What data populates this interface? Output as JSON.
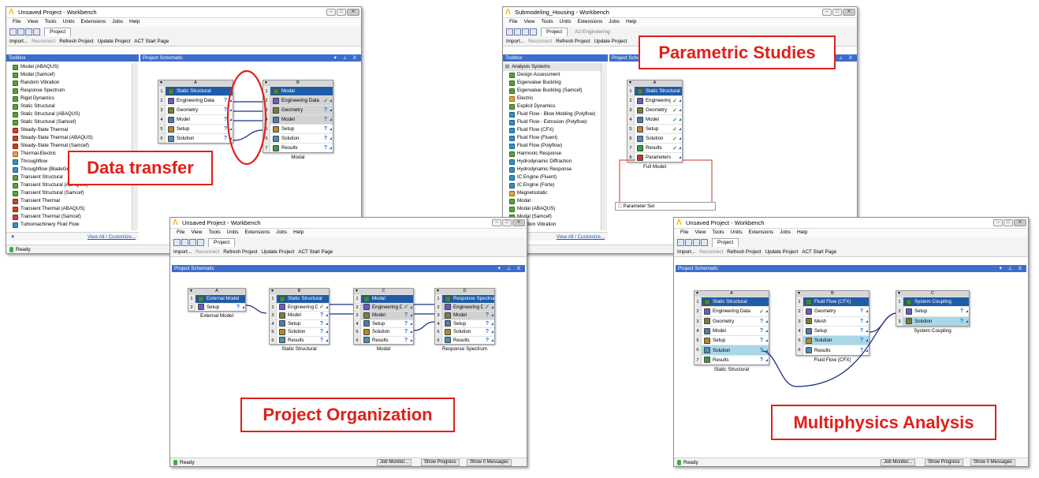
{
  "callouts": {
    "data_transfer": "Data transfer",
    "parametric": "Parametric Studies",
    "organization": "Project Organization",
    "multiphysics": "Multiphysics Analysis"
  },
  "common": {
    "file": "File",
    "view": "View",
    "tools": "Tools",
    "units": "Units",
    "extensions": "Extensions",
    "jobs": "Jobs",
    "help": "Help",
    "project_tab": "Project",
    "import": "Import...",
    "reconnect": "Reconnect",
    "refresh": "Refresh Project",
    "update": "Update Project",
    "act": "ACT Start Page",
    "schematic": "Project Schematic",
    "toolbox": "Toolbox",
    "ready": "Ready",
    "view_all": "View All / Customize...",
    "job_monitor": "Job Monitor...",
    "show_progress": "Show Progress",
    "show_messages": "Show 0 Messages",
    "ctl": "▾ ⊥ X"
  },
  "w1": {
    "title": "Unsaved Project - Workbench",
    "toolbox": [
      "Modal (ABAQUS)",
      "Modal (Samcef)",
      "Random Vibration",
      "Response Spectrum",
      "Rigid Dynamics",
      "Static Structural",
      "Static Structural (ABAQUS)",
      "Static Structural (Samcef)",
      "Steady-State Thermal",
      "Steady-State Thermal (ABAQUS)",
      "Steady-State Thermal (Samcef)",
      "Thermal-Electric",
      "Throughflow",
      "Throughflow (BladeGen)",
      "Transient Structural",
      "Transient Structural (ABAQUS)",
      "Transient Structural (Samcef)",
      "Transient Thermal",
      "Transient Thermal (ABAQUS)",
      "Transient Thermal (Samcef)",
      "Turbomachinery Fluid Flow"
    ],
    "sysA": {
      "letter": "A",
      "rows": [
        "Static Structural",
        "Engineering Data",
        "Geometry",
        "Model",
        "Setup",
        "Solution"
      ],
      "caption": ""
    },
    "sysB": {
      "letter": "B",
      "rows": [
        "Modal",
        "Engineering Data",
        "Geometry",
        "Model",
        "Setup",
        "Solution",
        "Results"
      ],
      "caption": "Modal"
    }
  },
  "w2": {
    "title": "Submodeling_Housing - Workbench",
    "tab2": "A2:Engineering",
    "toolbox": [
      "Analysis Systems",
      "Design Assessment",
      "Eigenvalue Buckling",
      "Eigenvalue Buckling (Samcef)",
      "Electric",
      "Explicit Dynamics",
      "Fluid Flow - Blow Molding (Polyflow)",
      "Fluid Flow - Extrusion (Polyflow)",
      "Fluid Flow (CFX)",
      "Fluid Flow (Fluent)",
      "Fluid Flow (Polyflow)",
      "Harmonic Response",
      "Hydrodynamic Diffraction",
      "Hydrodynamic Response",
      "IC Engine (Fluent)",
      "IC Engine (Forte)",
      "Magnetostatic",
      "Modal",
      "Modal (ABAQUS)",
      "Modal (Samcef)",
      "Random Vibration"
    ],
    "sysA": {
      "letter": "A",
      "rows": [
        "Static Structural",
        "Engineering Data",
        "Geometry",
        "Model",
        "Setup",
        "Solution",
        "Results",
        "Parameters"
      ],
      "caption": "Full Model"
    },
    "param_set": "Parameter Set"
  },
  "w3": {
    "title": "Unsaved Project - Workbench",
    "sysA": {
      "letter": "A",
      "rows": [
        "External Model",
        "Setup"
      ],
      "caption": "External Model"
    },
    "sysB": {
      "letter": "B",
      "rows": [
        "Static Structural",
        "Engineering Data",
        "Model",
        "Setup",
        "Solution",
        "Results"
      ],
      "caption": "Static Structural"
    },
    "sysC": {
      "letter": "C",
      "rows": [
        "Modal",
        "Engineering Data",
        "Model",
        "Setup",
        "Solution",
        "Results"
      ],
      "caption": "Modal"
    },
    "sysD": {
      "letter": "D",
      "rows": [
        "Response Spectrum",
        "Engineering Data",
        "Model",
        "Setup",
        "Solution",
        "Results"
      ],
      "caption": "Response Spectrum"
    }
  },
  "w4": {
    "title": "Unsaved Project - Workbench",
    "sysA": {
      "letter": "A",
      "rows": [
        "Static Structural",
        "Engineering Data",
        "Geometry",
        "Model",
        "Setup",
        "Solution",
        "Results"
      ],
      "caption": "Static Structural"
    },
    "sysB": {
      "letter": "B",
      "rows": [
        "Fluid Flow (CFX)",
        "Geometry",
        "Mesh",
        "Setup",
        "Solution",
        "Results"
      ],
      "caption": "Fluid Flow (CFX)"
    },
    "sysC": {
      "letter": "C",
      "rows": [
        "System Coupling",
        "Setup",
        "Solution"
      ],
      "caption": "System Coupling"
    }
  }
}
